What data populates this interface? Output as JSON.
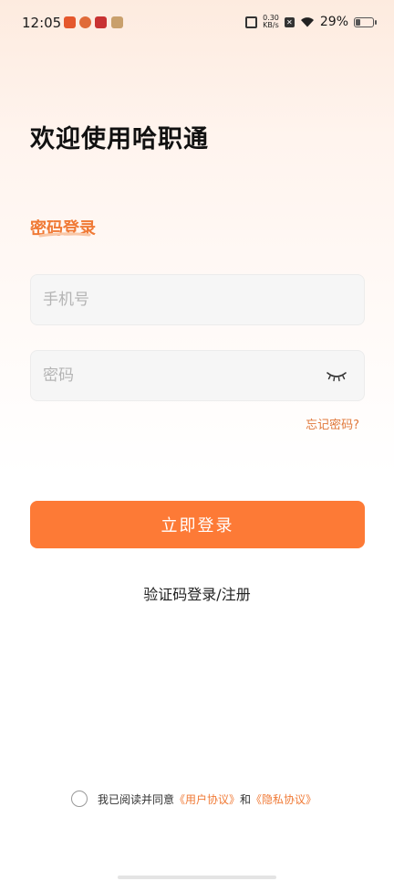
{
  "status_bar": {
    "time": "12:05",
    "speed_value": "0.30",
    "speed_unit": "KB/s",
    "battery_percent": "29%",
    "battery_level": 0.29,
    "icons": [
      "app-icon-1",
      "app-icon-2",
      "app-icon-3",
      "app-icon-4",
      "vibrate-icon",
      "x-icon",
      "wifi-icon",
      "battery-icon"
    ]
  },
  "welcome_title": "欢迎使用哈职通",
  "login_mode": "密码登录",
  "phone": {
    "value": "",
    "placeholder": "手机号"
  },
  "password": {
    "value": "",
    "placeholder": "密码",
    "toggle_icon": "eye-closed-icon"
  },
  "forgot_password": "忘记密码?",
  "login_button": "立即登录",
  "sms_register_link": "验证码登录/注册",
  "agreement": {
    "prefix": "我已阅读并同意",
    "user_agreement": "《用户协议》",
    "conjunction": "和",
    "privacy_agreement": "《隐私协议》",
    "checked": false
  },
  "colors": {
    "accent": "#fd7a36",
    "link": "#f07a36"
  }
}
